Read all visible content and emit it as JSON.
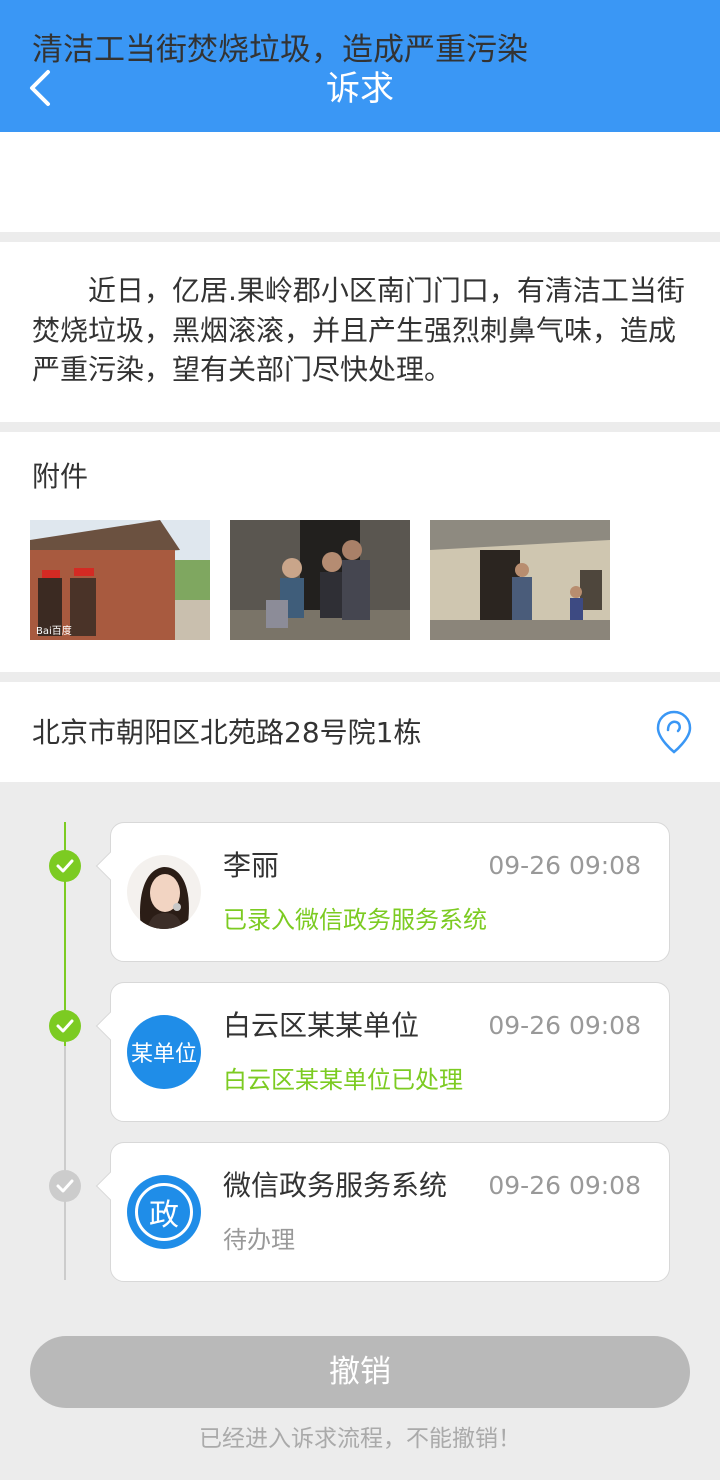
{
  "header": {
    "title": "诉求"
  },
  "complaint": {
    "title": "清洁工当街焚烧垃圾，造成严重污染",
    "description": "近日，亿居.果岭郡小区南门门口，有清洁工当街焚烧垃圾，黑烟滚滚，并且产生强烈刺鼻气味，造成严重污染，望有关部门尽快处理。"
  },
  "attachments": {
    "label": "附件",
    "watermark": "Bai百度"
  },
  "address": {
    "text": "北京市朝阳区北苑路28号院1栋"
  },
  "timeline": [
    {
      "name": "李丽",
      "time": "09-26  09:08",
      "status": "已录入微信政务服务系统",
      "done": true
    },
    {
      "name": "白云区某某单位",
      "avatar_text": "某单位",
      "time": "09-26  09:08",
      "status": "白云区某某单位已处理",
      "done": true
    },
    {
      "name": "微信政务服务系统",
      "avatar_text": "政",
      "time": "09-26  09:08",
      "status": "待办理",
      "done": false
    }
  ],
  "actions": {
    "revoke_label": "撤销",
    "hint": "已经进入诉求流程，不能撤销！"
  },
  "colors": {
    "primary": "#3a97f5",
    "done": "#7ccb22",
    "pending": "#cccccc",
    "disabled_button": "#b9b9b9"
  }
}
